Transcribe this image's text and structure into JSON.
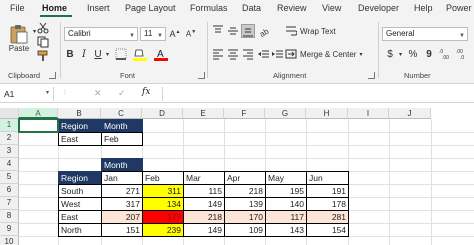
{
  "tabs": [
    "File",
    "Home",
    "Insert",
    "Page Layout",
    "Formulas",
    "Data",
    "Review",
    "View",
    "Developer",
    "Help",
    "Power"
  ],
  "ribbon": {
    "paste_label": "Paste",
    "clipboard_label": "Clipboard",
    "font_name": "Calibri",
    "font_size": "11",
    "font_group_label": "Font",
    "wrap_text_label": "Wrap Text",
    "merge_center_label": "Merge & Center",
    "alignment_label": "Alignment",
    "number_format": "General",
    "number_label": "Number",
    "bold": "B",
    "italic": "I",
    "underline": "U",
    "dollar": "$",
    "percent": "%",
    "comma": "9"
  },
  "formula_bar": {
    "name_box": "A1",
    "fx": "fx",
    "cancel": "✕",
    "enter": "✓"
  },
  "grid": {
    "columns": [
      "A",
      "B",
      "C",
      "D",
      "E",
      "F",
      "G",
      "H",
      "I",
      "J"
    ],
    "rows": [
      "1",
      "2",
      "3",
      "4",
      "5",
      "6",
      "7",
      "8",
      "9",
      "10"
    ],
    "lookup_headers": [
      "Region",
      "Month"
    ],
    "lookup_values": [
      "East",
      "Feb"
    ],
    "month_label": "Month",
    "table_headers": [
      "Region",
      "Jan",
      "Feb",
      "Mar",
      "Apr",
      "May",
      "Jun"
    ],
    "table_rows": [
      {
        "region": "South",
        "values": [
          "271",
          "311",
          "115",
          "218",
          "195",
          "191"
        ]
      },
      {
        "region": "West",
        "values": [
          "317",
          "134",
          "149",
          "139",
          "140",
          "178"
        ]
      },
      {
        "region": "East",
        "values": [
          "207",
          "177",
          "218",
          "170",
          "117",
          "281"
        ]
      },
      {
        "region": "North",
        "values": [
          "151",
          "239",
          "149",
          "109",
          "143",
          "154"
        ]
      }
    ]
  },
  "colors": {
    "header_fill": "#1f3864",
    "highlight_row": "#fce4d6",
    "highlight_col": "#ffff00",
    "intersection": "#ff0000",
    "accent": "#217346"
  }
}
